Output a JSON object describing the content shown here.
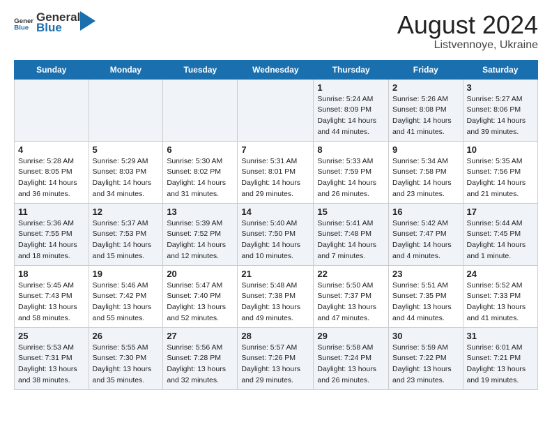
{
  "header": {
    "logo_general": "General",
    "logo_blue": "Blue",
    "title": "August 2024",
    "subtitle": "Listvennoye, Ukraine"
  },
  "days_of_week": [
    "Sunday",
    "Monday",
    "Tuesday",
    "Wednesday",
    "Thursday",
    "Friday",
    "Saturday"
  ],
  "weeks": [
    [
      {
        "day": "",
        "info": ""
      },
      {
        "day": "",
        "info": ""
      },
      {
        "day": "",
        "info": ""
      },
      {
        "day": "",
        "info": ""
      },
      {
        "day": "1",
        "info": "Sunrise: 5:24 AM\nSunset: 8:09 PM\nDaylight: 14 hours\nand 44 minutes."
      },
      {
        "day": "2",
        "info": "Sunrise: 5:26 AM\nSunset: 8:08 PM\nDaylight: 14 hours\nand 41 minutes."
      },
      {
        "day": "3",
        "info": "Sunrise: 5:27 AM\nSunset: 8:06 PM\nDaylight: 14 hours\nand 39 minutes."
      }
    ],
    [
      {
        "day": "4",
        "info": "Sunrise: 5:28 AM\nSunset: 8:05 PM\nDaylight: 14 hours\nand 36 minutes."
      },
      {
        "day": "5",
        "info": "Sunrise: 5:29 AM\nSunset: 8:03 PM\nDaylight: 14 hours\nand 34 minutes."
      },
      {
        "day": "6",
        "info": "Sunrise: 5:30 AM\nSunset: 8:02 PM\nDaylight: 14 hours\nand 31 minutes."
      },
      {
        "day": "7",
        "info": "Sunrise: 5:31 AM\nSunset: 8:01 PM\nDaylight: 14 hours\nand 29 minutes."
      },
      {
        "day": "8",
        "info": "Sunrise: 5:33 AM\nSunset: 7:59 PM\nDaylight: 14 hours\nand 26 minutes."
      },
      {
        "day": "9",
        "info": "Sunrise: 5:34 AM\nSunset: 7:58 PM\nDaylight: 14 hours\nand 23 minutes."
      },
      {
        "day": "10",
        "info": "Sunrise: 5:35 AM\nSunset: 7:56 PM\nDaylight: 14 hours\nand 21 minutes."
      }
    ],
    [
      {
        "day": "11",
        "info": "Sunrise: 5:36 AM\nSunset: 7:55 PM\nDaylight: 14 hours\nand 18 minutes."
      },
      {
        "day": "12",
        "info": "Sunrise: 5:37 AM\nSunset: 7:53 PM\nDaylight: 14 hours\nand 15 minutes."
      },
      {
        "day": "13",
        "info": "Sunrise: 5:39 AM\nSunset: 7:52 PM\nDaylight: 14 hours\nand 12 minutes."
      },
      {
        "day": "14",
        "info": "Sunrise: 5:40 AM\nSunset: 7:50 PM\nDaylight: 14 hours\nand 10 minutes."
      },
      {
        "day": "15",
        "info": "Sunrise: 5:41 AM\nSunset: 7:48 PM\nDaylight: 14 hours\nand 7 minutes."
      },
      {
        "day": "16",
        "info": "Sunrise: 5:42 AM\nSunset: 7:47 PM\nDaylight: 14 hours\nand 4 minutes."
      },
      {
        "day": "17",
        "info": "Sunrise: 5:44 AM\nSunset: 7:45 PM\nDaylight: 14 hours\nand 1 minute."
      }
    ],
    [
      {
        "day": "18",
        "info": "Sunrise: 5:45 AM\nSunset: 7:43 PM\nDaylight: 13 hours\nand 58 minutes."
      },
      {
        "day": "19",
        "info": "Sunrise: 5:46 AM\nSunset: 7:42 PM\nDaylight: 13 hours\nand 55 minutes."
      },
      {
        "day": "20",
        "info": "Sunrise: 5:47 AM\nSunset: 7:40 PM\nDaylight: 13 hours\nand 52 minutes."
      },
      {
        "day": "21",
        "info": "Sunrise: 5:48 AM\nSunset: 7:38 PM\nDaylight: 13 hours\nand 49 minutes."
      },
      {
        "day": "22",
        "info": "Sunrise: 5:50 AM\nSunset: 7:37 PM\nDaylight: 13 hours\nand 47 minutes."
      },
      {
        "day": "23",
        "info": "Sunrise: 5:51 AM\nSunset: 7:35 PM\nDaylight: 13 hours\nand 44 minutes."
      },
      {
        "day": "24",
        "info": "Sunrise: 5:52 AM\nSunset: 7:33 PM\nDaylight: 13 hours\nand 41 minutes."
      }
    ],
    [
      {
        "day": "25",
        "info": "Sunrise: 5:53 AM\nSunset: 7:31 PM\nDaylight: 13 hours\nand 38 minutes."
      },
      {
        "day": "26",
        "info": "Sunrise: 5:55 AM\nSunset: 7:30 PM\nDaylight: 13 hours\nand 35 minutes."
      },
      {
        "day": "27",
        "info": "Sunrise: 5:56 AM\nSunset: 7:28 PM\nDaylight: 13 hours\nand 32 minutes."
      },
      {
        "day": "28",
        "info": "Sunrise: 5:57 AM\nSunset: 7:26 PM\nDaylight: 13 hours\nand 29 minutes."
      },
      {
        "day": "29",
        "info": "Sunrise: 5:58 AM\nSunset: 7:24 PM\nDaylight: 13 hours\nand 26 minutes."
      },
      {
        "day": "30",
        "info": "Sunrise: 5:59 AM\nSunset: 7:22 PM\nDaylight: 13 hours\nand 23 minutes."
      },
      {
        "day": "31",
        "info": "Sunrise: 6:01 AM\nSunset: 7:21 PM\nDaylight: 13 hours\nand 19 minutes."
      }
    ]
  ]
}
